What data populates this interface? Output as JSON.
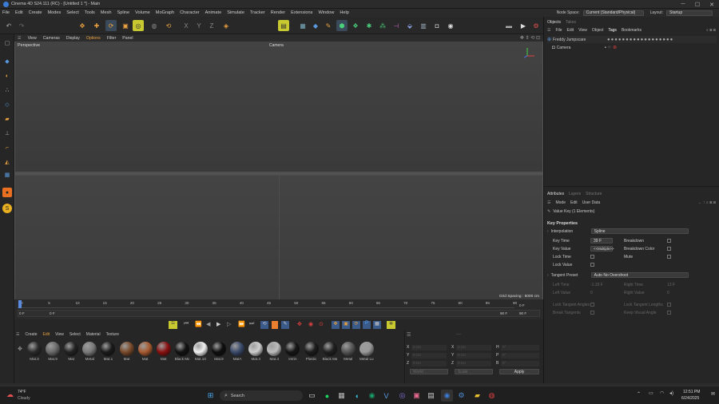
{
  "window": {
    "title": "Cinema 4D S24.111 (RC) - [Untitled 1 *] - Main",
    "minimize": "─",
    "maximize": "☐",
    "close": "✕"
  },
  "menu": {
    "items": [
      "File",
      "Edit",
      "Create",
      "Modes",
      "Select",
      "Tools",
      "Mesh",
      "Spline",
      "Volume",
      "MoGraph",
      "Character",
      "Animate",
      "Simulate",
      "Tracker",
      "Render",
      "Extensions",
      "Window",
      "Help"
    ],
    "node_space_label": "Node Space:",
    "node_space_value": "Current (Standard/Physical)",
    "layout_label": "Layout:",
    "layout_value": "Startup"
  },
  "viewport": {
    "menu": [
      "View",
      "Cameras",
      "Display",
      "Options",
      "Filter",
      "Panel"
    ],
    "name": "Perspective",
    "camera": "Camera",
    "grid_spacing": "Grid Spacing : 5000 cm"
  },
  "timeline": {
    "ticks": [
      "0",
      "5",
      "10",
      "15",
      "20",
      "25",
      "30",
      "35",
      "40",
      "45",
      "50",
      "55",
      "60",
      "65",
      "70",
      "75",
      "80",
      "85",
      "90"
    ],
    "current_frame_marker": "0 F",
    "start_field": "0 F",
    "mid_field": "0 F",
    "end_field": "90 F",
    "end_field2": "90 F",
    "left_field": "0 F"
  },
  "materials": {
    "menu": [
      "Create",
      "Edit",
      "View",
      "Select",
      "Material",
      "Texture"
    ],
    "items": [
      {
        "label": "Mat.3",
        "color": "#2a2a2a"
      },
      {
        "label": "Mat.9",
        "color": "#6a6a6a"
      },
      {
        "label": "Mat",
        "color": "#222222"
      },
      {
        "label": "Metal",
        "color": "#7a7a7a"
      },
      {
        "label": "Mat.1",
        "color": "#1a1a1a"
      },
      {
        "label": "Mat",
        "color": "#7a4a2a"
      },
      {
        "label": "Mat",
        "color": "#a85a30"
      },
      {
        "label": "Mat",
        "color": "#8a1010"
      },
      {
        "label": "Black Ma",
        "color": "#111111"
      },
      {
        "label": "Mat.10",
        "color": "#f0f0f0"
      },
      {
        "label": "Mat.9",
        "color": "#0e0e0e"
      },
      {
        "label": "MatA",
        "color": "#3a4a6a"
      },
      {
        "label": "Mat.4",
        "color": "#cfcfcf"
      },
      {
        "label": "Mat.4",
        "color": "#bcbcbc"
      },
      {
        "label": "Intrin",
        "color": "#151515"
      },
      {
        "label": "Plastic",
        "color": "#1b1b1b"
      },
      {
        "label": "Black Ma",
        "color": "#202020"
      },
      {
        "label": "Metal",
        "color": "#555555"
      },
      {
        "label": "Metal Lu",
        "color": "#999999"
      }
    ]
  },
  "coords": {
    "x": "X",
    "y": "Y",
    "z": "Z",
    "h": "H",
    "p": "P",
    "b": "B",
    "x_val": "0 cm",
    "y_val": "0 cm",
    "z_val": "0 cm",
    "sx": "0 cm",
    "sy": "0 cm",
    "sz": "0 cm",
    "h_val": "0°",
    "p_val": "0°",
    "b_val": "0°",
    "mode1": "World",
    "mode2": "Scale",
    "apply": "Apply"
  },
  "objects": {
    "tabs": [
      "Objects",
      "Takes"
    ],
    "menu": [
      "File",
      "Edit",
      "View",
      "Object",
      "Tags",
      "Bookmarks"
    ],
    "items": [
      {
        "name": "Freddy Jumpscare"
      },
      {
        "name": "Camera"
      }
    ]
  },
  "attributes": {
    "tabs": [
      "Attributes",
      "Layers",
      "Structure"
    ],
    "menu": [
      "Mode",
      "Edit",
      "User Data"
    ],
    "subtitle": "Value Key (1 Elements)",
    "section": "Key Properties",
    "interpolation_label": "Interpolation",
    "interpolation_value": "Spline",
    "key_time_label": "Key Time",
    "key_time_value": "39 F",
    "breakdown_label": "Breakdown",
    "key_value_label": "Key Value",
    "key_value_value": "<<Multiple>>",
    "breakdown_color_label": "Breakdown Color",
    "lock_time_label": "Lock Time",
    "mute_label": "Mute",
    "lock_value_label": "Lock Value",
    "tangent_preset_label": "Tangent Preset",
    "tangent_preset_value": "Auto No Overshoot",
    "left_time_label": "Left Time",
    "left_time_value": "-1.33 F",
    "right_time_label": "Right Time",
    "right_time_value": "13 F",
    "left_value_label": "Left Value",
    "left_value_value": "0",
    "right_value_label": "Right Value",
    "right_value_value": "0",
    "lock_tangent_angles": "Lock Tangent Angles",
    "lock_tangent_lengths": "Lock Tangent Lengths",
    "break_tangents": "Break Tangents",
    "keep_visual_angle": "Keep Visual Angle"
  },
  "taskbar": {
    "weather_temp": "74°F",
    "weather_text": "Cloudy",
    "search": "Search",
    "time": "12:51 PM",
    "date": "6/24/2025"
  }
}
